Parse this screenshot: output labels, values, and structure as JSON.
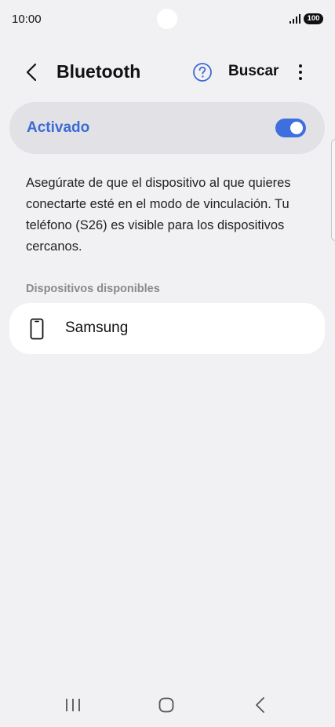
{
  "status_bar": {
    "time": "10:00",
    "battery": "100"
  },
  "header": {
    "title": "Bluetooth",
    "search_label": "Buscar",
    "icons": [
      "back-icon",
      "help-icon",
      "more-options-icon"
    ]
  },
  "bluetooth_switch": {
    "label": "Activado",
    "state": true,
    "accent_color": "#3f6fde"
  },
  "description": "Asegúrate de que el dispositivo al que quieres conectarte esté en el modo de vinculación. Tu teléfono (S26) es visible para los dispositivos cercanos.",
  "available_devices": {
    "header": "Dispositivos disponibles",
    "items": [
      {
        "name": "Samsung",
        "icon": "phone-icon"
      }
    ]
  },
  "nav_bar": {
    "icons": [
      "recent-apps-icon",
      "home-icon",
      "back-icon"
    ]
  }
}
